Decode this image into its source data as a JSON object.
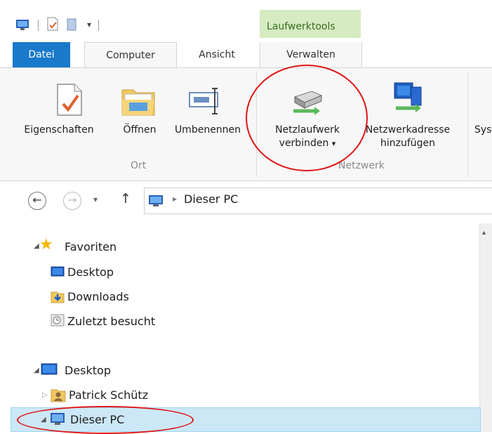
{
  "contextual_tab_group": "Laufwerktools",
  "tabs": {
    "file": "Datei",
    "computer": "Computer",
    "view": "Ansicht",
    "manage": "Verwalten"
  },
  "ribbon": {
    "properties": "Eigenschaften",
    "open": "Öffnen",
    "rename": "Umbenennen",
    "map_drive_line1": "Netzlaufwerk",
    "map_drive_line2": "verbinden",
    "map_drive_arrow": "▾",
    "add_location_line1": "Netzwerkadresse",
    "add_location_line2": "hinzufügen",
    "system_partial": "Sys",
    "group_location": "Ort",
    "group_network": "Netzwerk"
  },
  "address": {
    "separator": "▸",
    "path": "Dieser PC"
  },
  "tree": {
    "favorites": "Favoriten",
    "desktop_fav": "Desktop",
    "downloads": "Downloads",
    "recent": "Zuletzt besucht",
    "desktop": "Desktop",
    "user": "Patrick Schütz",
    "this_pc": "Dieser PC"
  },
  "colors": {
    "file_tab": "#1979ca",
    "contextual": "#d6ebc1",
    "selection": "#cce8f6",
    "annotation": "#e01515"
  }
}
